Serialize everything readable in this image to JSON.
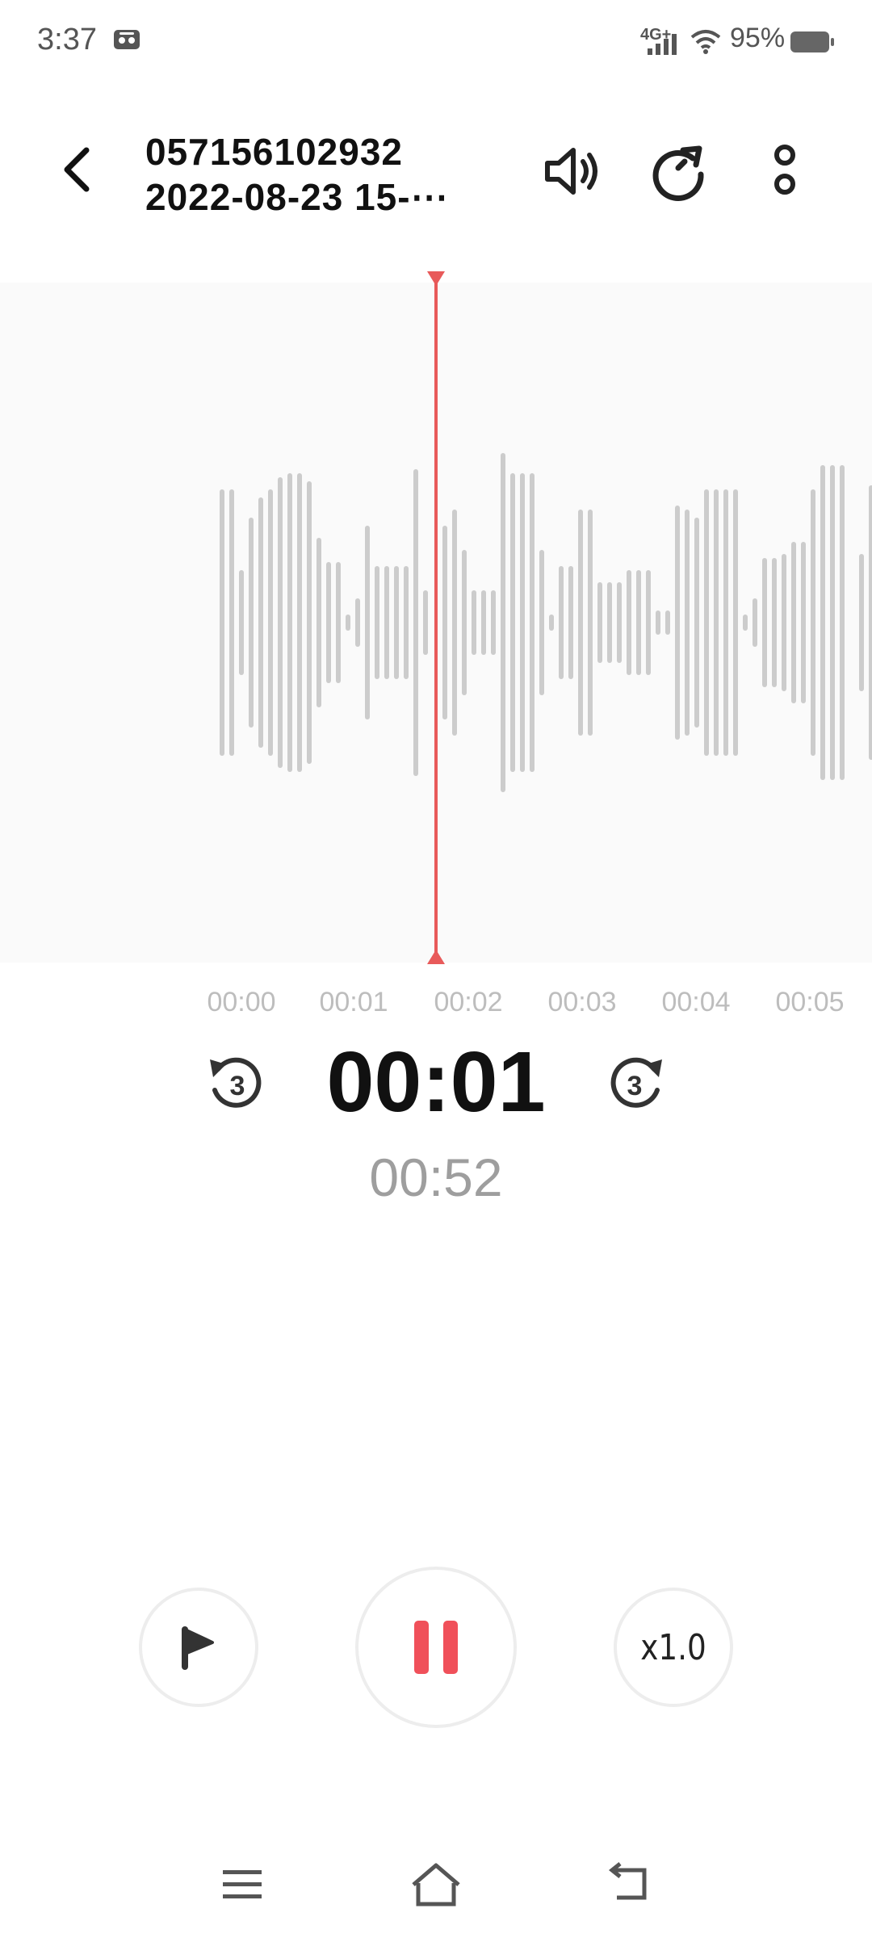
{
  "status_bar": {
    "time": "3:37",
    "network": "4G+",
    "battery": "95%"
  },
  "header": {
    "title_line1": "057156102932",
    "title_line2": "2022-08-23 15-⋯"
  },
  "timeline": {
    "ticks": [
      "00:00",
      "00:01",
      "00:02",
      "00:03",
      "00:04",
      "00:05"
    ]
  },
  "playback": {
    "current_time": "00:01",
    "total_time": "00:52",
    "speed_label": "x1.0",
    "skip_seconds": "3"
  },
  "colors": {
    "accent": "#f0505a",
    "playhead": "#e85a5a",
    "waveform_bar": "#cccccc",
    "waveform_bg": "#fafafa"
  },
  "icons": {
    "back": "back-chevron-icon",
    "speaker": "speaker-icon",
    "rotate": "rotate-icon",
    "more": "more-vertical-icon",
    "rewind": "rewind-3s-icon",
    "forward": "forward-3s-icon",
    "flag": "flag-icon",
    "pause": "pause-icon",
    "nav_menu": "menu-icon",
    "nav_home": "home-icon",
    "nav_back": "nav-back-icon"
  }
}
